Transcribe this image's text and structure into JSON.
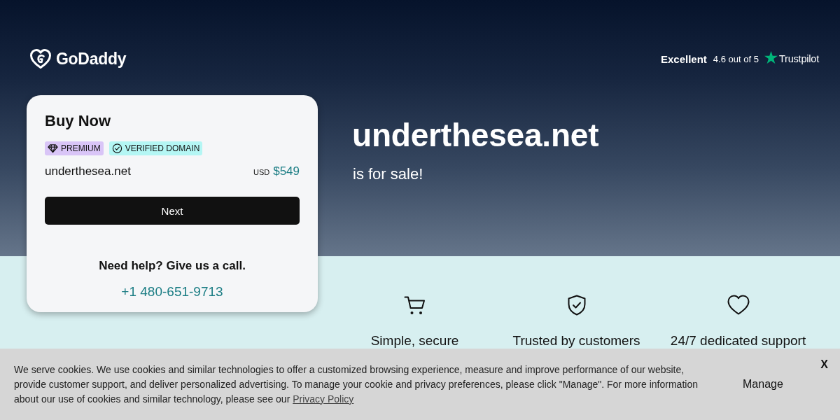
{
  "header": {
    "logo_text": "GoDaddy",
    "rating": {
      "label": "Excellent",
      "score": "4.6 out of 5",
      "brand": "Trustpilot"
    }
  },
  "card": {
    "title": "Buy Now",
    "badges": [
      {
        "kind": "premium",
        "label": "PREMIUM",
        "color": "#d9c5f7"
      },
      {
        "kind": "verified",
        "label": "VERIFIED DOMAIN",
        "color": "#b4f6f4"
      }
    ],
    "domain": "underthesea.net",
    "currency": "USD",
    "price": "$549",
    "button": "Next",
    "help": "Need help? Give us a call.",
    "phone": "+1 480-651-9713"
  },
  "hero": {
    "domain": "underthesea.net",
    "subtitle": "is for sale!"
  },
  "features": [
    {
      "kind": "cart",
      "title": "Simple, secure"
    },
    {
      "kind": "shield",
      "title": "Trusted by customers"
    },
    {
      "kind": "heart",
      "title": "24/7 dedicated support"
    }
  ],
  "cookie_banner": {
    "text": "We serve cookies. We use cookies and similar technologies to offer a customized browsing experience, measure and improve performance of our website, provide customer support, and deliver personalized advertising. To manage your cookie and privacy preferences, please click \"Manage\". For more information about our use of cookies and similar technology, please see our",
    "link": "Privacy Policy",
    "button": "Manage",
    "close": "X"
  }
}
